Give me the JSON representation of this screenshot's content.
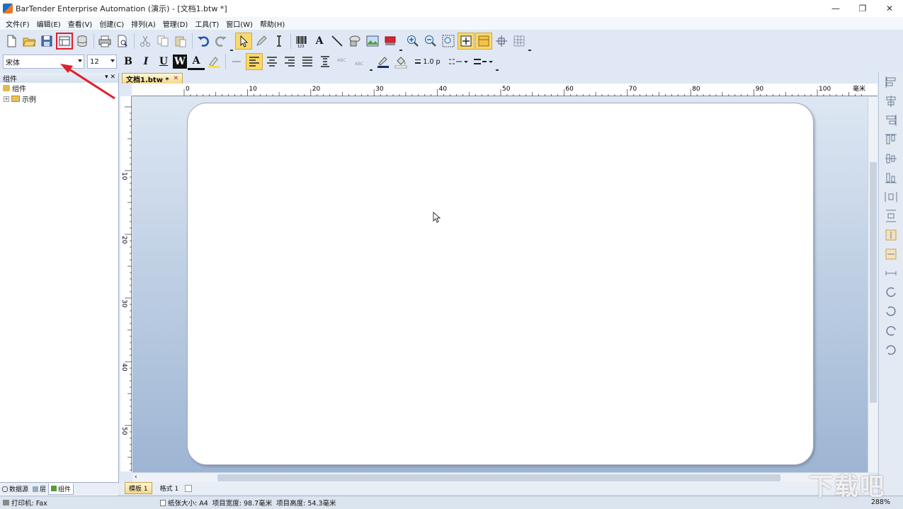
{
  "window": {
    "title": "BarTender Enterprise Automation (演示) - [文档1.btw *]",
    "minimize": "—",
    "maximize": "❐",
    "close": "✕"
  },
  "menu": [
    "文件(F)",
    "编辑(E)",
    "查看(V)",
    "创建(C)",
    "排列(A)",
    "管理(D)",
    "工具(T)",
    "窗口(W)",
    "帮助(H)"
  ],
  "format_toolbar": {
    "font": "宋体",
    "size": "12",
    "bold": "B",
    "italic": "I",
    "underline": "U",
    "wordwrap": "W",
    "text_color": "A",
    "line_width": "1.0 p"
  },
  "left_panel": {
    "title": "组件",
    "pin": "▾ ✕",
    "tree": [
      {
        "label": "组件"
      },
      {
        "label": "示例",
        "expander": "+"
      }
    ]
  },
  "left_tabs": [
    "数据源",
    "层",
    "组件"
  ],
  "doc_tab": {
    "label": "文档1.btw *",
    "close": "✕"
  },
  "ruler": {
    "h_labels": [
      "0",
      "10",
      "20",
      "30",
      "40",
      "50",
      "60",
      "70",
      "80",
      "90",
      "100"
    ],
    "h_unit": "毫米",
    "v_labels": [
      "10",
      "20",
      "30",
      "40",
      "50"
    ]
  },
  "sheet_tabs": [
    "模板 1",
    "格式 1"
  ],
  "status": {
    "printer": "打印机: Fax",
    "paper": "纸张大小: A4",
    "width": "项目宽度: 98.7毫米",
    "height": "项目高度: 54.3毫米",
    "zoom": "288%"
  },
  "watermark": "下载吧",
  "colors": {
    "highlight": "#e0202a",
    "accent": "#f4d98a"
  }
}
